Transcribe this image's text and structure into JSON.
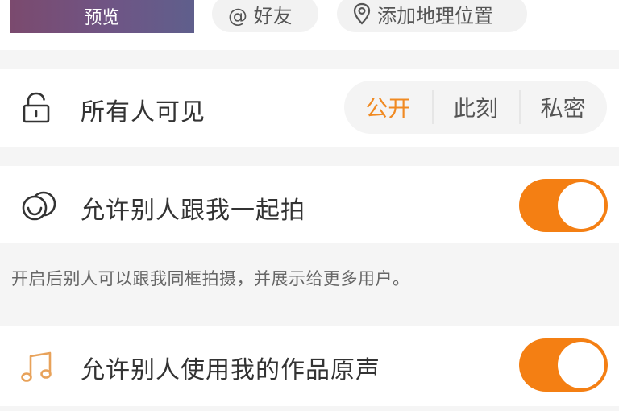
{
  "top": {
    "preview_label": "预览",
    "friends_chip": "@ 好友",
    "location_chip": "添加地理位置"
  },
  "visibility": {
    "label": "所有人可见",
    "options": [
      "公开",
      "此刻",
      "私密"
    ],
    "selected": "公开",
    "accent_color": "#f08a22"
  },
  "together": {
    "label": "允许别人跟我一起拍",
    "enabled": true,
    "hint": "开启后别人可以跟我同框拍摄，并展示给更多用户。"
  },
  "sound": {
    "label": "允许别人使用我的作品原声",
    "enabled": true
  },
  "colors": {
    "toggle_on": "#f47f13"
  },
  "icons": {
    "friends": "at-icon",
    "location": "location-pin-icon",
    "visibility": "unlock-icon",
    "together": "duet-icon",
    "sound": "music-note-icon"
  }
}
